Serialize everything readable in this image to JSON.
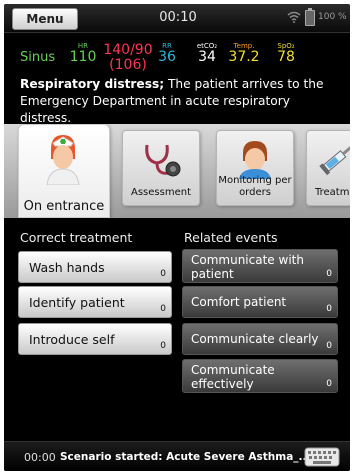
{
  "status": {
    "menu_label": "Menu",
    "clock": "00:10",
    "battery_pct": "100 %"
  },
  "vitals": {
    "rhythm": "Sinus",
    "hr": {
      "label": "HR",
      "value": "110",
      "color": "#5fd34a"
    },
    "bp": {
      "value": "140/90",
      "sub": "(106)",
      "color": "#ff3355"
    },
    "rr": {
      "label": "RR",
      "value": "36",
      "color": "#2db7d6"
    },
    "etco2": {
      "label": "etCO₂",
      "value": "34",
      "color": "#ffffff"
    },
    "temp": {
      "label": "Temp.",
      "value": "37.2",
      "color": "#ff9a1a"
    },
    "spo2": {
      "label": "SpO₂",
      "value": "78",
      "color": "#f3df2c"
    }
  },
  "description": {
    "bold": "Respiratory distress;",
    "text": " The patient arrives to the Emergency Department in acute respiratory distress."
  },
  "categories": [
    {
      "label": "On entrance",
      "icon": "nurse-icon",
      "active": true
    },
    {
      "label": "Assessment",
      "icon": "stethoscope-icon",
      "active": false
    },
    {
      "label": "Monitoring per orders",
      "icon": "patient-monitoring-icon",
      "active": false
    },
    {
      "label": "Treatm",
      "icon": "syringe-icon",
      "active": false
    }
  ],
  "correct_treatment": {
    "title": "Correct treatment",
    "items": [
      {
        "label": "Wash hands",
        "count": "0"
      },
      {
        "label": "Identify patient",
        "count": "0"
      },
      {
        "label": "Introduce self",
        "count": "0"
      }
    ]
  },
  "related_events": {
    "title": "Related events",
    "items": [
      {
        "label": "Communicate with patient",
        "count": "0"
      },
      {
        "label": "Comfort patient",
        "count": "0"
      },
      {
        "label": "Communicate clearly",
        "count": "0"
      },
      {
        "label": "Communicate effectively",
        "count": "0"
      }
    ]
  },
  "footer": {
    "time": "00:00",
    "scenario": "Scenario started: Acute Severe Asthma_..."
  }
}
